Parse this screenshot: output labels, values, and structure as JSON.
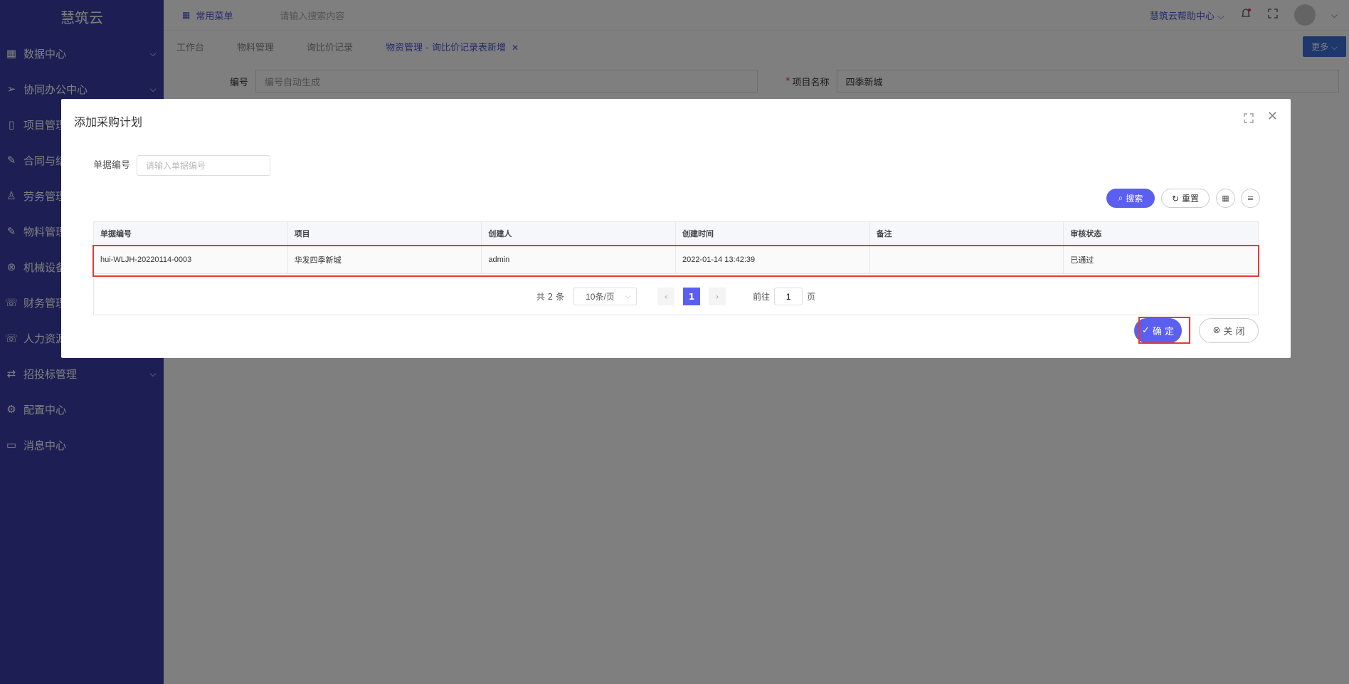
{
  "app": {
    "logo": "慧筑云"
  },
  "sidebar": {
    "items": [
      {
        "label": "数据中心",
        "icon": "grid-icon",
        "expandable": true
      },
      {
        "label": "协同办公中心",
        "icon": "send-icon",
        "expandable": true
      },
      {
        "label": "项目管理",
        "icon": "book-icon",
        "expandable": false
      },
      {
        "label": "合同与结",
        "icon": "edit-icon",
        "expandable": false
      },
      {
        "label": "劳务管理",
        "icon": "user-icon",
        "expandable": false
      },
      {
        "label": "物料管理",
        "icon": "edit-icon",
        "expandable": false
      },
      {
        "label": "机械设备",
        "icon": "circle-x-icon",
        "expandable": false
      },
      {
        "label": "财务管理",
        "icon": "phone-icon",
        "expandable": false
      },
      {
        "label": "人力资源",
        "icon": "phone-icon",
        "expandable": false
      },
      {
        "label": "招投标管理",
        "icon": "exchange-icon",
        "expandable": true
      },
      {
        "label": "配置中心",
        "icon": "gear-icon",
        "expandable": false
      },
      {
        "label": "消息中心",
        "icon": "message-icon",
        "expandable": false
      }
    ]
  },
  "header": {
    "common_menu": "常用菜单",
    "search_placeholder": "请输入搜索内容",
    "help": "慧筑云帮助中心"
  },
  "tabs": {
    "items": [
      "工作台",
      "物料管理",
      "询比价记录",
      "物资管理 - 询比价记录表新增"
    ],
    "more": "更多"
  },
  "bgform": {
    "code_label": "编号",
    "code_placeholder": "编号自动生成",
    "project_label": "项目名称",
    "project_value": "四季新城"
  },
  "dialog": {
    "title": "添加采购计划",
    "filter_label": "单据编号",
    "filter_placeholder": "请输入单据编号",
    "search_btn": "搜索",
    "reset_btn": "重置",
    "table": {
      "headers": [
        "单据编号",
        "项目",
        "创建人",
        "创建时间",
        "备注",
        "审核状态"
      ],
      "rows": [
        [
          "hui-WLJH-20220114-0003",
          "华发四季新城",
          "admin",
          "2022-01-14 13:42:39",
          "",
          "已通过"
        ]
      ]
    },
    "pager": {
      "total": "共 2 条",
      "page_size": "10条/页",
      "current": "1",
      "goto_label": "前往",
      "goto_value": "1",
      "page_suffix": "页"
    },
    "ok_btn": "确 定",
    "close_btn": "关 闭"
  },
  "colors": {
    "sidebar": "#3b3fa8",
    "accent": "#5b5ff0",
    "highlight": "#e53935"
  }
}
